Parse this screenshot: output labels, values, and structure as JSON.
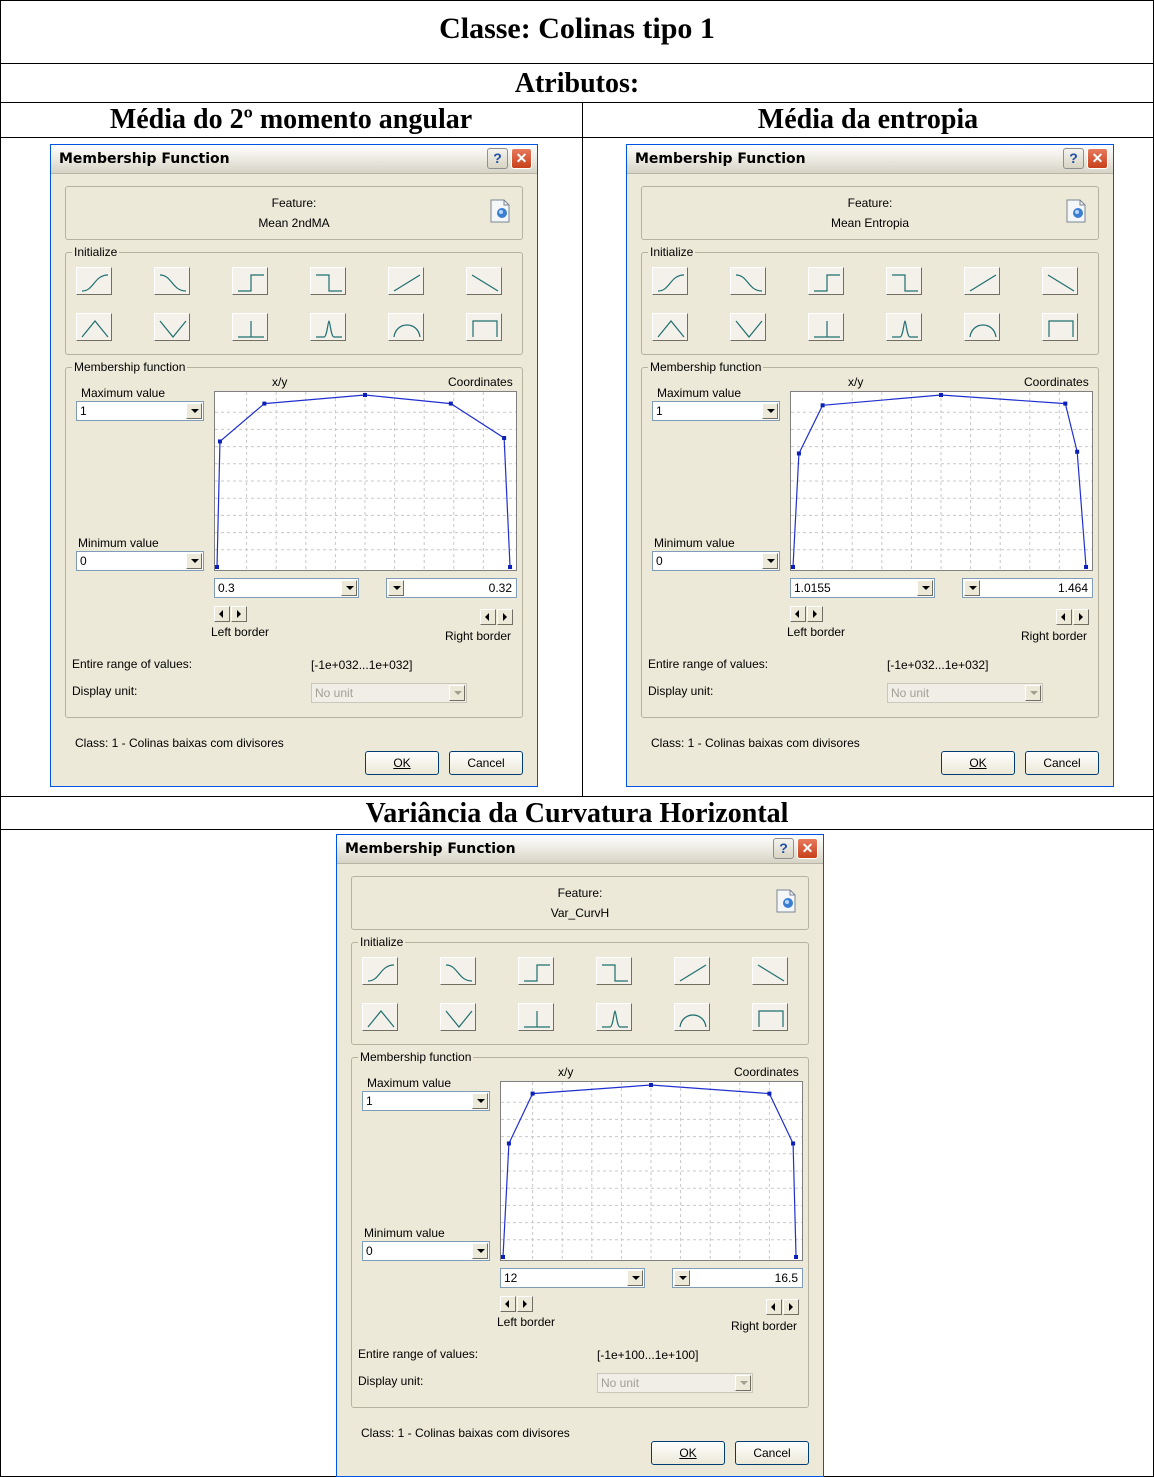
{
  "document": {
    "class_title": "Classe: Colinas tipo 1",
    "attributes_title": "Atributos:",
    "cells": [
      {
        "heading": "Média do 2º momento angular"
      },
      {
        "heading": "Média da entropia"
      },
      {
        "heading": "Variância da Curvatura Horizontal"
      }
    ]
  },
  "dialogs": [
    {
      "title": "Membership Function",
      "feature_label": "Feature:",
      "feature_name": "Mean 2ndMA",
      "initialize_label": "Initialize",
      "membership_label": "Membership function",
      "xy_label": "x/y",
      "coordinates_label": "Coordinates",
      "max_label": "Maximum value",
      "max_value": "1",
      "min_label": "Minimum value",
      "min_value": "0",
      "left_value": "0.3",
      "right_value": "0.32",
      "left_border_label": "Left border",
      "right_border_label": "Right border",
      "range_label": "Entire range of values:",
      "range_value": "[-1e+032...1e+032]",
      "unit_label": "Display unit:",
      "unit_value": "No unit",
      "class_text": "Class: 1 - Colinas baixas com divisores",
      "ok_label": "OK",
      "cancel_label": "Cancel",
      "curve": [
        [
          0,
          0
        ],
        [
          0.01,
          0.73
        ],
        [
          0.16,
          0.95
        ],
        [
          0.5,
          1.0
        ],
        [
          0.79,
          0.95
        ],
        [
          0.97,
          0.75
        ],
        [
          0.99,
          0
        ]
      ]
    },
    {
      "title": "Membership Function",
      "feature_label": "Feature:",
      "feature_name": "Mean Entropia",
      "initialize_label": "Initialize",
      "membership_label": "Membership function",
      "xy_label": "x/y",
      "coordinates_label": "Coordinates",
      "max_label": "Maximum value",
      "max_value": "1",
      "min_label": "Minimum value",
      "min_value": "0",
      "left_value": "1.0155",
      "right_value": "1.464",
      "left_border_label": "Left border",
      "right_border_label": "Right border",
      "range_label": "Entire range of values:",
      "range_value": "[-1e+032...1e+032]",
      "unit_label": "Display unit:",
      "unit_value": "No unit",
      "class_text": "Class: 1 - Colinas baixas com divisores",
      "ok_label": "OK",
      "cancel_label": "Cancel",
      "curve": [
        [
          0,
          0
        ],
        [
          0.02,
          0.66
        ],
        [
          0.1,
          0.94
        ],
        [
          0.5,
          1.0
        ],
        [
          0.92,
          0.95
        ],
        [
          0.96,
          0.67
        ],
        [
          0.99,
          0
        ]
      ]
    },
    {
      "title": "Membership Function",
      "feature_label": "Feature:",
      "feature_name": "Var_CurvH",
      "initialize_label": "Initialize",
      "membership_label": "Membership function",
      "xy_label": "x/y",
      "coordinates_label": "Coordinates",
      "max_label": "Maximum value",
      "max_value": "1",
      "min_label": "Minimum value",
      "min_value": "0",
      "left_value": "12",
      "right_value": "16.5",
      "left_border_label": "Left border",
      "right_border_label": "Right border",
      "range_label": "Entire range of values:",
      "range_value": "[-1e+100...1e+100]",
      "unit_label": "Display unit:",
      "unit_value": "No unit",
      "class_text": "Class: 1 - Colinas baixas com divisores",
      "ok_label": "OK",
      "cancel_label": "Cancel",
      "curve": [
        [
          0,
          0
        ],
        [
          0.02,
          0.66
        ],
        [
          0.1,
          0.95
        ],
        [
          0.5,
          1.0
        ],
        [
          0.9,
          0.95
        ],
        [
          0.98,
          0.66
        ],
        [
          0.99,
          0
        ]
      ]
    }
  ]
}
